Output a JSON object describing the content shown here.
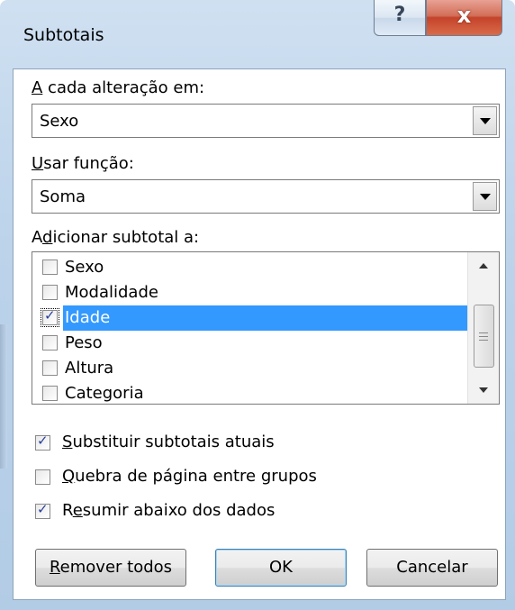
{
  "window": {
    "title": "Subtotais",
    "help_glyph": "?",
    "close_glyph": "x"
  },
  "fields": {
    "change_label_key": "A",
    "change_label_rest": " cada alteração em:",
    "change_value": "Sexo",
    "function_label_key": "U",
    "function_label_rest": "sar função:",
    "function_value": "Soma",
    "add_label_pre": "A",
    "add_label_key": "d",
    "add_label_rest": "icionar subtotal a:"
  },
  "list": {
    "items": [
      {
        "label": "Sexo",
        "checked": false,
        "selected": false
      },
      {
        "label": "Modalidade",
        "checked": false,
        "selected": false
      },
      {
        "label": "Idade",
        "checked": true,
        "selected": true
      },
      {
        "label": "Peso",
        "checked": false,
        "selected": false
      },
      {
        "label": "Altura",
        "checked": false,
        "selected": false
      },
      {
        "label": "Categoria",
        "checked": false,
        "selected": false
      }
    ]
  },
  "options": {
    "replace_key": "S",
    "replace_rest": "ubstituir subtotais atuais",
    "replace_checked": true,
    "pagebreak_key": "Q",
    "pagebreak_rest": "uebra de página entre grupos",
    "pagebreak_checked": false,
    "summary_pre": "R",
    "summary_key": "e",
    "summary_rest": "sumir abaixo dos dados",
    "summary_checked": true
  },
  "buttons": {
    "remove_key": "R",
    "remove_rest": "emover todos",
    "ok": "OK",
    "cancel": "Cancelar"
  },
  "colors": {
    "selection": "#3399ff",
    "close_button": "#c4432a",
    "titlebar": "#cfe0f1"
  }
}
